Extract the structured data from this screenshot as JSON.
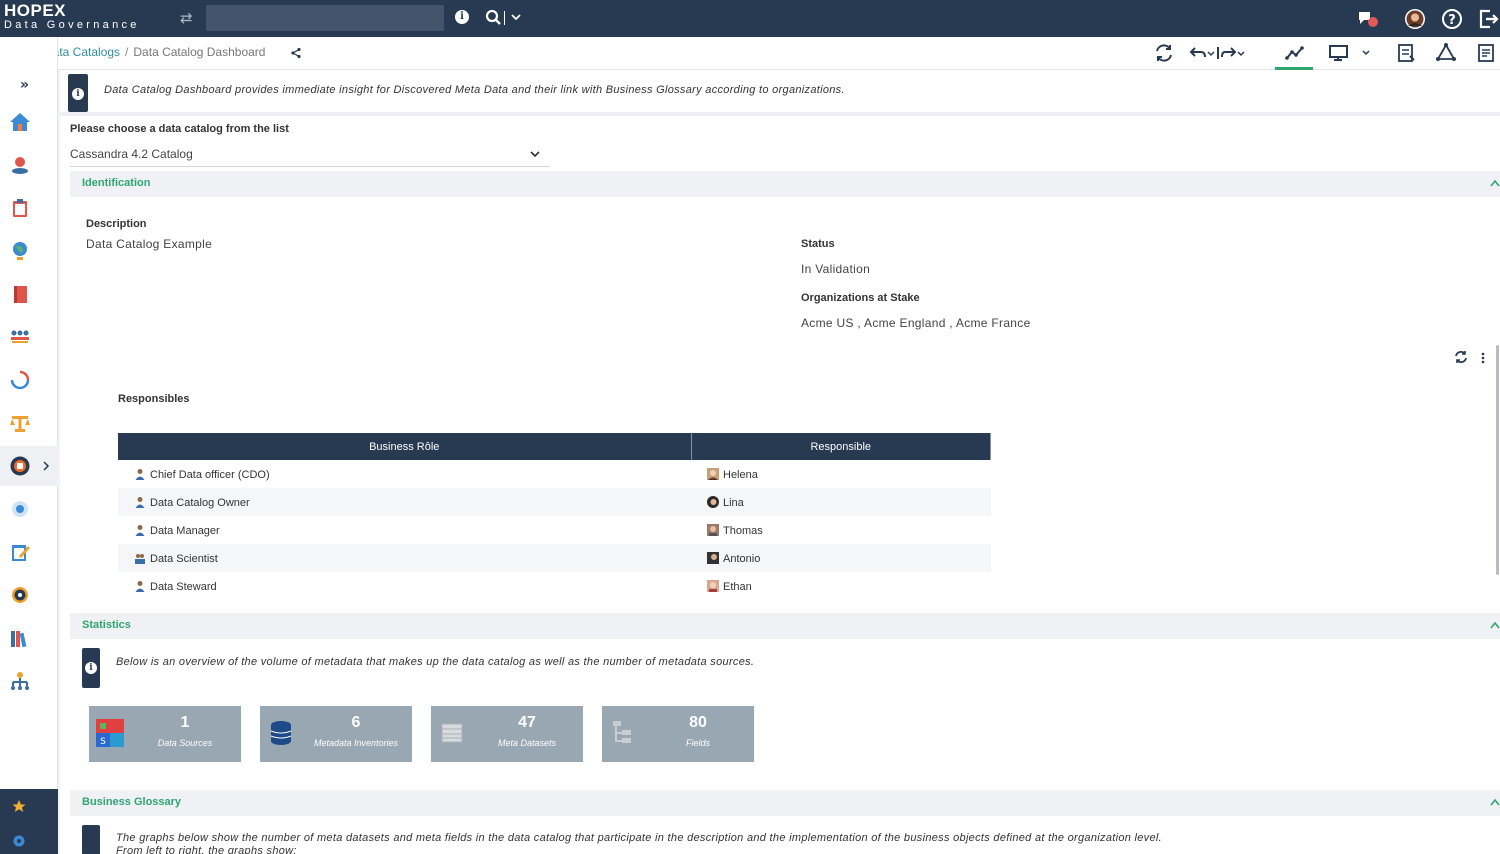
{
  "app": {
    "title": "HOPEX",
    "subtitle": "Data Governance"
  },
  "topbar": {
    "search_placeholder": ""
  },
  "breadcrumb": {
    "items": [
      "Data Catalogs",
      "Data Catalog Dashboard"
    ],
    "separator": "/"
  },
  "info_banner": {
    "text": "Data Catalog Dashboard provides immediate insight for Discovered Meta Data and their link with Business Glossary according to organizations."
  },
  "catalog_picker": {
    "label": "Please choose a data catalog from the list",
    "selected": "Cassandra 4.2 Catalog"
  },
  "identification": {
    "title": "Identification",
    "description_label": "Description",
    "description_value": "Data Catalog Example",
    "status_label": "Status",
    "status_value": "In Validation",
    "orgs_label": "Organizations at Stake",
    "orgs_value": "Acme US , Acme England , Acme France",
    "responsibles_label": "Responsibles"
  },
  "responsibles_table": {
    "columns": [
      "Business Rôle",
      "Responsible"
    ],
    "rows": [
      {
        "role": "Chief Data officer (CDO)",
        "person": "Helena"
      },
      {
        "role": "Data Catalog Owner",
        "person": "Lina"
      },
      {
        "role": "Data Manager",
        "person": "Thomas"
      },
      {
        "role": "Data Scientist",
        "person": "Antonio"
      },
      {
        "role": "Data Steward",
        "person": "Ethan"
      }
    ]
  },
  "statistics": {
    "title": "Statistics",
    "info": "Below is an overview of the volume of metadata that makes up the data catalog as well as the number of metadata sources.",
    "tiles": [
      {
        "value": "1",
        "label": "Data Sources",
        "icon": "data-sources-icon"
      },
      {
        "value": "6",
        "label": "Metadata Inventories",
        "icon": "database-icon"
      },
      {
        "value": "47",
        "label": "Meta Datasets",
        "icon": "table-icon"
      },
      {
        "value": "80",
        "label": "Fields",
        "icon": "tree-icon"
      }
    ]
  },
  "glossary": {
    "title": "Business Glossary",
    "line1": "The graphs below show the number of meta datasets and meta fields in the data catalog that participate in the description and the implementation of the business objects defined at the organization level.",
    "line2": "From left to right, the graphs show:"
  },
  "colors": {
    "navy": "#273a52",
    "accent_green": "#2fa572",
    "link_teal": "#2f8fa0",
    "tile_gray": "#99a7b3"
  }
}
